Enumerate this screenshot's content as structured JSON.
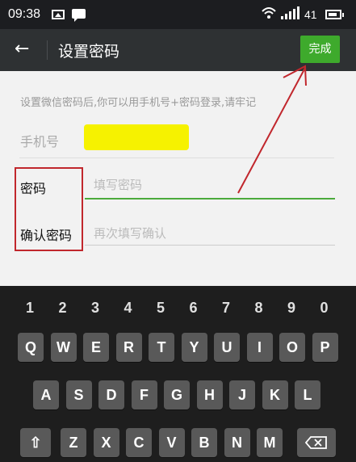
{
  "status_bar": {
    "time": "09:38",
    "battery": "41"
  },
  "header": {
    "back_icon": "←",
    "title": "设置密码",
    "done_button": "完成"
  },
  "form": {
    "hint": "设置微信密码后,你可以用手机号+密码登录,请牢记",
    "phone_label": "手机号",
    "password_label": "密码",
    "password_placeholder": "填写密码",
    "confirm_label": "确认密码",
    "confirm_placeholder": "再次填写确认"
  },
  "annotation": {
    "box_color": "#c1272d",
    "arrow_color": "#c1272d"
  },
  "keyboard": {
    "numbers": [
      "1",
      "2",
      "3",
      "4",
      "5",
      "6",
      "7",
      "8",
      "9",
      "0"
    ],
    "row1": [
      "Q",
      "W",
      "E",
      "R",
      "T",
      "Y",
      "U",
      "I",
      "O",
      "P"
    ],
    "row2": [
      "A",
      "S",
      "D",
      "F",
      "G",
      "H",
      "J",
      "K",
      "L"
    ],
    "row3": [
      "Z",
      "X",
      "C",
      "V",
      "B",
      "N",
      "M"
    ],
    "shift_icon": "⇧",
    "backspace_icon": "backspace-icon"
  },
  "colors": {
    "accent": "#3eaa2c",
    "highlight": "#f6f200"
  }
}
